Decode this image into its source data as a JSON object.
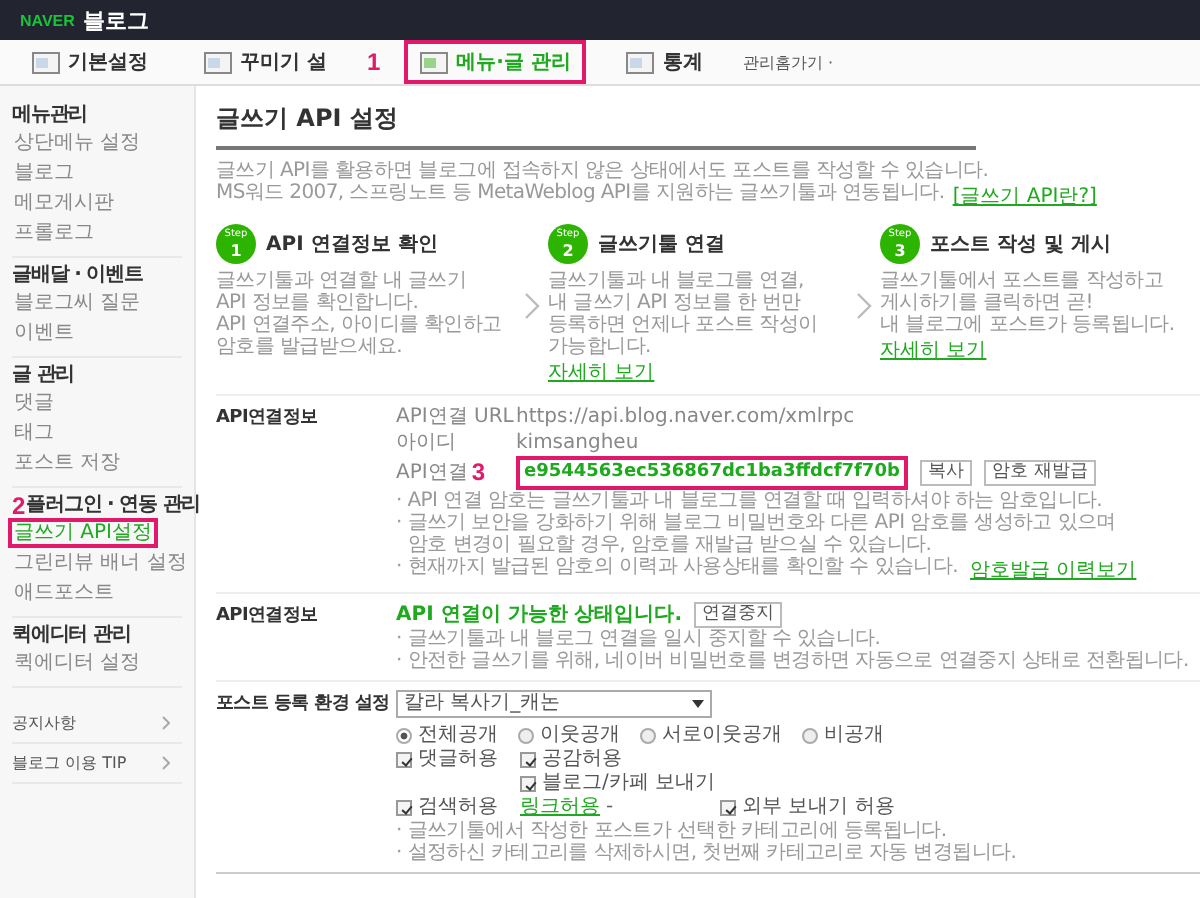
{
  "header": {
    "brand": "NAVER",
    "title": "블로그"
  },
  "tabs": [
    {
      "label": "기본설정",
      "selected": false,
      "highlighted": false
    },
    {
      "label": "꾸미기 설",
      "selected": false,
      "highlighted": false,
      "marker": "1"
    },
    {
      "label": "메뉴·글 관리",
      "selected": true,
      "highlighted": true
    },
    {
      "label": "통계",
      "selected": false,
      "highlighted": false
    }
  ],
  "home_link": "관리홈가기 ·",
  "sidebar": {
    "groups": [
      {
        "title": "메뉴관리",
        "items": [
          {
            "label": "상단메뉴 설정",
            "selected": false,
            "highlighted": false
          },
          {
            "label": "블로그",
            "selected": false,
            "highlighted": false
          },
          {
            "label": "메모게시판",
            "selected": false,
            "highlighted": false
          },
          {
            "label": "프롤로그",
            "selected": false,
            "highlighted": false
          }
        ]
      },
      {
        "title": "글배달 · 이벤트",
        "items": [
          {
            "label": "블로그씨 질문",
            "selected": false,
            "highlighted": false
          },
          {
            "label": "이벤트",
            "selected": false,
            "highlighted": false
          }
        ]
      },
      {
        "title": "글 관리",
        "items": [
          {
            "label": "댓글",
            "selected": false,
            "highlighted": false
          },
          {
            "label": "태그",
            "selected": false,
            "highlighted": false
          },
          {
            "label": "포스트 저장",
            "selected": false,
            "highlighted": false
          }
        ]
      },
      {
        "title": "플러그인 · 연동 관리",
        "marker": "2",
        "items": [
          {
            "label": "글쓰기 API설정",
            "selected": true,
            "highlighted": true
          },
          {
            "label": "그린리뷰 배너 설정",
            "selected": false,
            "highlighted": false
          },
          {
            "label": "애드포스트",
            "selected": false,
            "highlighted": false
          }
        ]
      },
      {
        "title": "퀵에디터 관리",
        "items": [
          {
            "label": "퀵에디터 설정",
            "selected": false,
            "highlighted": false
          }
        ]
      }
    ],
    "links": [
      "공지사항",
      "블로그 이용 TIP"
    ]
  },
  "main": {
    "title": "글쓰기 API 설정",
    "intro": [
      "글쓰기 API를 활용하면 블로그에 접속하지 않은 상태에서도 포스트를 작성할 수 있습니다.",
      "MS워드 2007, 스프링노트 등 MetaWeblog API를 지원하는 글쓰기툴과 연동됩니다."
    ],
    "intro_link": "[글쓰기 API란?]",
    "steps": [
      {
        "badge": "Step",
        "number": "1",
        "title": "API 연결정보 확인",
        "lines": [
          "글쓰기툴과 연결할 내 글쓰기",
          "API 정보를 확인합니다.",
          "API 연결주소, 아이디를 확인하고",
          "암호를 발급받으세요."
        ]
      },
      {
        "badge": "Step",
        "number": "2",
        "title": "글쓰기툴 연결",
        "lines": [
          "글쓰기툴과 내 블로그를 연결,",
          "내 글쓰기 API 정보를 한 번만",
          "등록하면 언제나 포스트 작성이",
          "가능합니다."
        ],
        "link": "자세히 보기"
      },
      {
        "badge": "Step",
        "number": "3",
        "title": "포스트 작성 및 게시",
        "lines": [
          "글쓰기툴에서 포스트를 작성하고",
          "게시하기를 클릭하면 곧!",
          "내 블로그에 포스트가 등록됩니다."
        ],
        "link": "자세히 보기"
      }
    ],
    "api_info": {
      "label": "API연결정보",
      "rows": [
        {
          "label": "API연결 URL",
          "value": "https://api.blog.naver.com/xmlrpc",
          "highlighted": false
        },
        {
          "label": "아이디",
          "value": "kimsangheu",
          "highlighted": false
        },
        {
          "label": "API연결",
          "value": "e9544563ec536867dc1ba3ffdcf7f70b",
          "marker": "3",
          "highlighted": true,
          "buttons": [
            "복사",
            "암호 재발급"
          ]
        }
      ],
      "notes": [
        {
          "lines": [
            "· API 연결 암호는 글쓰기툴과 내 블로그를 연결할 때 입력하셔야 하는 암호입니다."
          ]
        },
        {
          "lines": [
            "· 글쓰기 보안을 강화하기 위해 블로그 비밀번호와 다른 API 암호를 생성하고 있으며",
            "암호 변경이 필요할 경우, 암호를 재발급 받으실 수 있습니다."
          ]
        },
        {
          "lines": [
            "· 현재까지 발급된 암호의 이력과 사용상태를 확인할 수 있습니다."
          ],
          "link": "암호발급 이력보기"
        }
      ]
    },
    "connection": {
      "label": "API연결정보",
      "status": "API 연결이 가능한 상태입니다.",
      "button": "연결중지",
      "notes": [
        "· 글쓰기툴과 내 블로그 연결을 일시 중지할 수 있습니다.",
        "· 안전한 글쓰기를 위해, 네이버 비밀번호를 변경하면 자동으로 연결중지 상태로 전환됩니다."
      ]
    },
    "post_settings": {
      "label": "포스트 등록 환경 설정",
      "select": "칼라 복사기_캐논",
      "radios": [
        {
          "label": "전체공개",
          "selected": true
        },
        {
          "label": "이웃공개",
          "selected": false
        },
        {
          "label": "서로이웃공개",
          "selected": false
        },
        {
          "label": "비공개",
          "selected": false
        }
      ],
      "checkbox_rows": [
        [
          {
            "label": "댓글허용",
            "checked": true
          },
          {
            "label": "공감허용",
            "checked": true
          }
        ],
        [
          {
            "label": "검색허용",
            "checked": true
          },
          {
            "label": "블로그/카페 보내기",
            "checked": true,
            "sublink": "링크허용",
            "suffix": "-"
          },
          {
            "label": "외부 보내기 허용",
            "checked": true
          }
        ]
      ],
      "notes": [
        "· 글쓰기툴에서 작성한 포스트가 선택한 카테고리에 등록됩니다.",
        "· 설정하신 카테고리를 삭제하시면, 첫번째 카테고리로 자동 변경됩니다."
      ]
    }
  }
}
